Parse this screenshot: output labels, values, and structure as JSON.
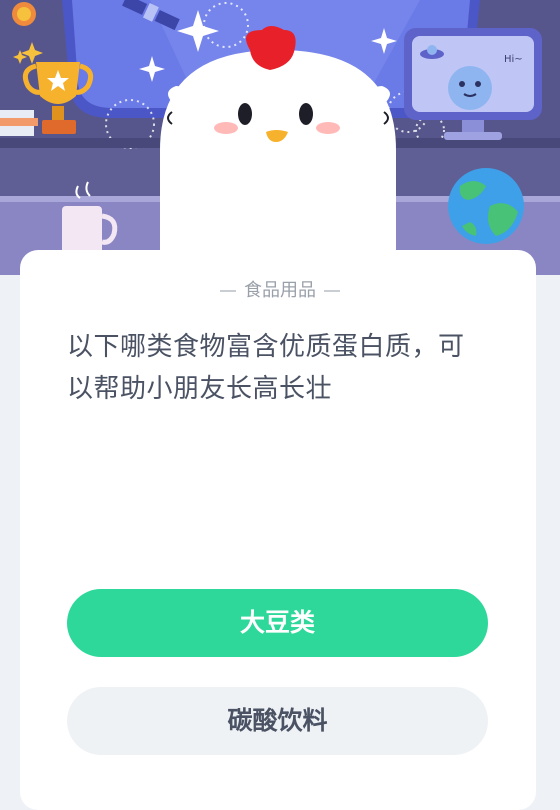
{
  "category": "食品用品",
  "question": {
    "line1": "以下哪类食物富含优质蛋白质，可",
    "line2": "以帮助小朋友长高长壮"
  },
  "options": [
    {
      "label": "大豆类",
      "selected": true
    },
    {
      "label": "碳酸饮料",
      "selected": false
    }
  ],
  "scene": {
    "monitor_text": "Hi~"
  },
  "colors": {
    "primary_green": "#2ed89a",
    "secondary_gray": "#eff2f5",
    "text_dark": "#4a5263",
    "scene_purple": "#5f5f96"
  }
}
